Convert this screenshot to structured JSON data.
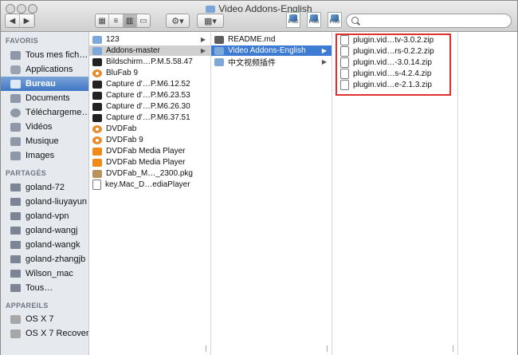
{
  "window": {
    "title": "Video Addons-English"
  },
  "toolbar": {
    "back_label": "◀",
    "forward_label": "▶",
    "view_labels": [
      "▦",
      "≡",
      "▥",
      "▭"
    ],
    "action_label": "⚙▾",
    "arrange_label": "▦▾",
    "file_icon_text": [
      "PNG",
      "PNG",
      "PNG"
    ],
    "search": {
      "value": "",
      "placeholder": ""
    }
  },
  "sidebar": {
    "favoris_header": "FAVORIS",
    "favoris": [
      "Tous mes fich…",
      "Applications",
      "Bureau",
      "Documents",
      "Téléchargeme…",
      "Vidéos",
      "Musique",
      "Images"
    ],
    "partages_header": "PARTAGÉS",
    "partages": [
      "goland-72",
      "goland-liuyayun",
      "goland-vpn",
      "goland-wangj",
      "goland-wangk",
      "goland-zhangjb",
      "Wilson_mac",
      "Tous…"
    ],
    "appareils_header": "APPAREILS",
    "appareils": [
      "OS X 7",
      "OS X 7 Recovery"
    ]
  },
  "columns": {
    "col1": [
      "123",
      "Addons-master",
      "Bildschirm…P.M.5.58.47",
      "BluFab 9",
      "Capture d'…P.M6.12.52",
      "Capture d'…P.M6.23.53",
      "Capture d'…P.M6.26.30",
      "Capture d'…P.M6.37.51",
      "DVDFab",
      "DVDFab 9",
      "DVDFab Media Player",
      "DVDFab Media Player",
      "DVDFab_M…_2300.pkg",
      "key.Mac_D…ediaPlayer"
    ],
    "col2": [
      "README.md",
      "Video Addons-English",
      "中文视频插件"
    ],
    "col3": [
      "plugin.vid…tv-3.0.2.zip",
      "plugin.vid…rs-0.2.2.zip",
      "plugin.vid…-3.0.14.zip",
      "plugin.vid…s-4.2.4.zip",
      "plugin.vid…e-2.1.3.zip"
    ]
  },
  "colors": {
    "selection_blue": "#3e7bd2",
    "highlight_red": "#e03030",
    "sidebar_bg": "#e6eaef"
  }
}
